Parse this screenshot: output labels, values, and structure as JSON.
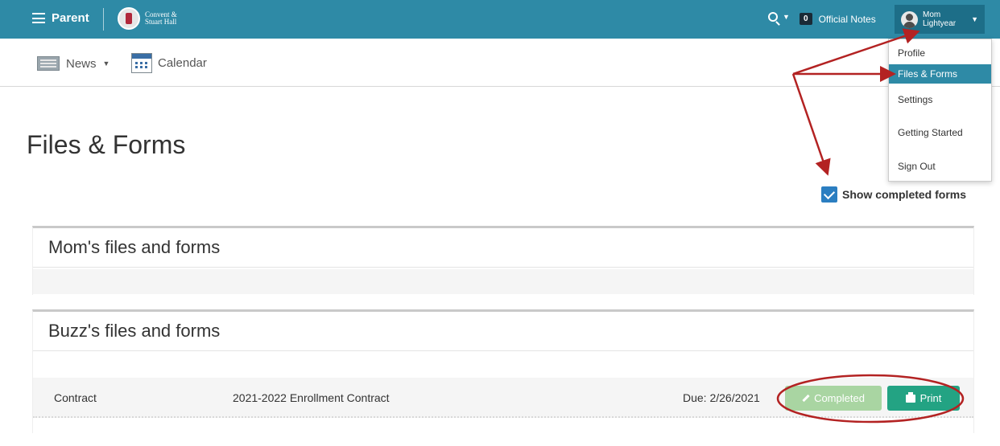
{
  "topbar": {
    "menu_label": "Parent",
    "logo_line1": "Convent &",
    "logo_line2": "Stuart Hall",
    "official_notes_count": "0",
    "official_notes_label": "Official Notes",
    "user_first": "Mom",
    "user_last": "Lightyear",
    "bar_color": "#2e8aa6"
  },
  "subnav": {
    "news_label": "News",
    "calendar_label": "Calendar"
  },
  "page": {
    "title": "Files & Forms",
    "show_completed_label": "Show completed forms",
    "show_completed_checked": true
  },
  "sections": [
    {
      "heading": "Mom's files and forms",
      "rows": []
    },
    {
      "heading": "Buzz's files and forms",
      "rows": [
        {
          "type": "Contract",
          "name": "2021-2022 Enrollment Contract",
          "due": "Due: 2/26/2021",
          "status_button": "Completed",
          "print_button": "Print"
        }
      ]
    }
  ],
  "user_menu": {
    "items": [
      "Profile",
      "Files & Forms",
      "Settings",
      "Getting Started",
      "Sign Out"
    ],
    "active_item": "Files & Forms"
  },
  "annotation_color": "#b32222"
}
